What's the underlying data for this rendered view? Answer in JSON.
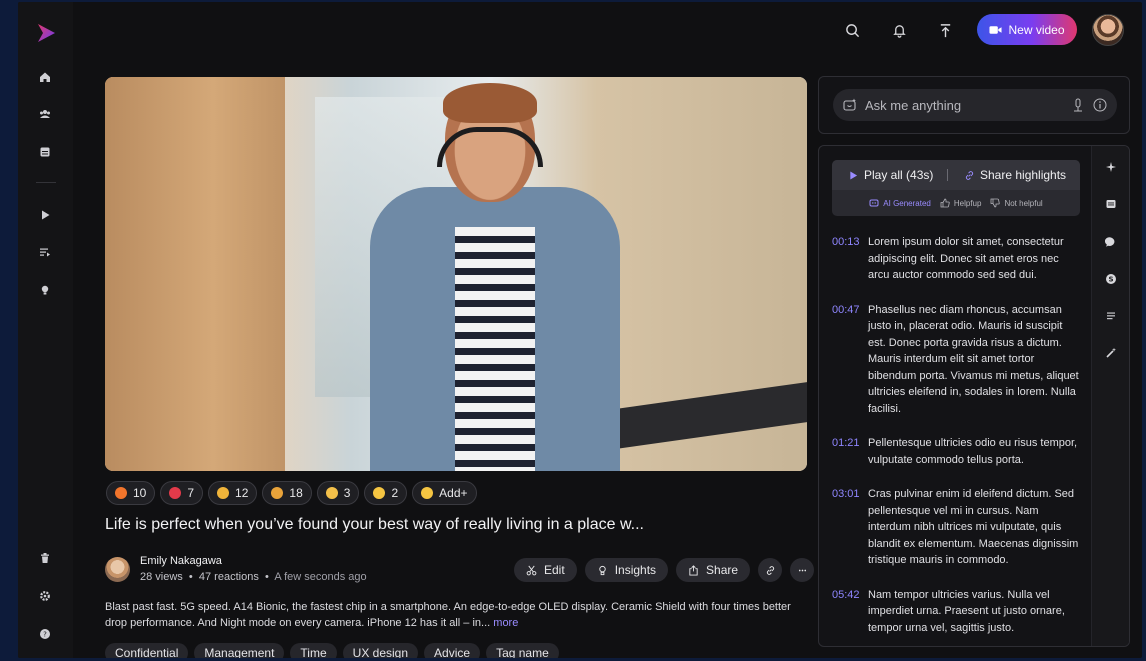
{
  "sidebar": {
    "items": [
      {
        "icon": "home-icon"
      },
      {
        "icon": "team-icon"
      },
      {
        "icon": "library-icon"
      },
      {
        "icon": "play-icon"
      },
      {
        "icon": "playlist-icon"
      },
      {
        "icon": "bulb-icon"
      },
      {
        "icon": "trash-icon"
      },
      {
        "icon": "gear-icon"
      },
      {
        "icon": "help-icon"
      }
    ]
  },
  "header": {
    "new_video_label": "New video"
  },
  "reactions": [
    {
      "emoji": "fire",
      "color": "#f2752c",
      "count": "10"
    },
    {
      "emoji": "heart",
      "color": "#e23a4a",
      "count": "7"
    },
    {
      "emoji": "raised-hands",
      "color": "#f0b43a",
      "count": "12"
    },
    {
      "emoji": "party-popper",
      "color": "#e9a33a",
      "count": "18"
    },
    {
      "emoji": "clap",
      "color": "#f3c04a",
      "count": "3"
    },
    {
      "emoji": "surprised",
      "color": "#f5c542",
      "count": "2"
    },
    {
      "emoji": "add-reaction",
      "color": "#f5c542",
      "count": "Add+"
    }
  ],
  "video": {
    "title": "Life is perfect when you’ve found your best way of really living in a place w...",
    "author": "Emily Nakagawa",
    "views": "28 views",
    "reactions_count": "47 reactions",
    "time": "A few seconds ago",
    "description": "Blast past fast. 5G speed. A14 Bionic, the fastest chip in a smartphone. An edge-to-edge OLED display. Ceramic Shield with four times better drop performance. And Night mode on every camera. iPhone 12 has it all – in...",
    "more_label": "more",
    "tags": [
      "Confidential",
      "Management",
      "Time",
      "UX design",
      "Advice",
      "Tag name"
    ]
  },
  "actions": {
    "edit_label": "Edit",
    "insights_label": "Insights",
    "share_label": "Share"
  },
  "ask": {
    "placeholder": "Ask me anything"
  },
  "highlights": {
    "play_all_label": "Play all (43s)",
    "share_label": "Share highlights",
    "ai_generated_label": "AI Generated",
    "helpful_label": "Helpfup",
    "not_helpful_label": "Not helpful"
  },
  "transcript": [
    {
      "time": "00:13",
      "text": "Lorem ipsum dolor sit amet, consectetur adipiscing elit. Donec sit amet eros nec arcu auctor commodo sed sed dui."
    },
    {
      "time": "00:47",
      "text": "Phasellus nec diam rhoncus, accumsan justo in, placerat odio. Mauris id suscipit est. Donec porta gravida risus a dictum. Mauris interdum elit sit amet tortor bibendum porta. Vivamus mi metus, aliquet ultricies eleifend in, sodales in lorem. Nulla facilisi."
    },
    {
      "time": "01:21",
      "text": "Pellentesque ultricies odio eu risus tempor, vulputate commodo tellus porta."
    },
    {
      "time": "03:01",
      "text": "Cras pulvinar enim id eleifend dictum. Sed pellentesque vel mi in cursus. Nam interdum nibh ultrices mi vulputate, quis blandit ex elementum. Maecenas dignissim tristique mauris in commodo."
    },
    {
      "time": "05:42",
      "text": "Nam tempor ultricies varius. Nulla vel imperdiet urna. Praesent ut justo ornare, tempor urna vel, sagittis justo."
    }
  ]
}
